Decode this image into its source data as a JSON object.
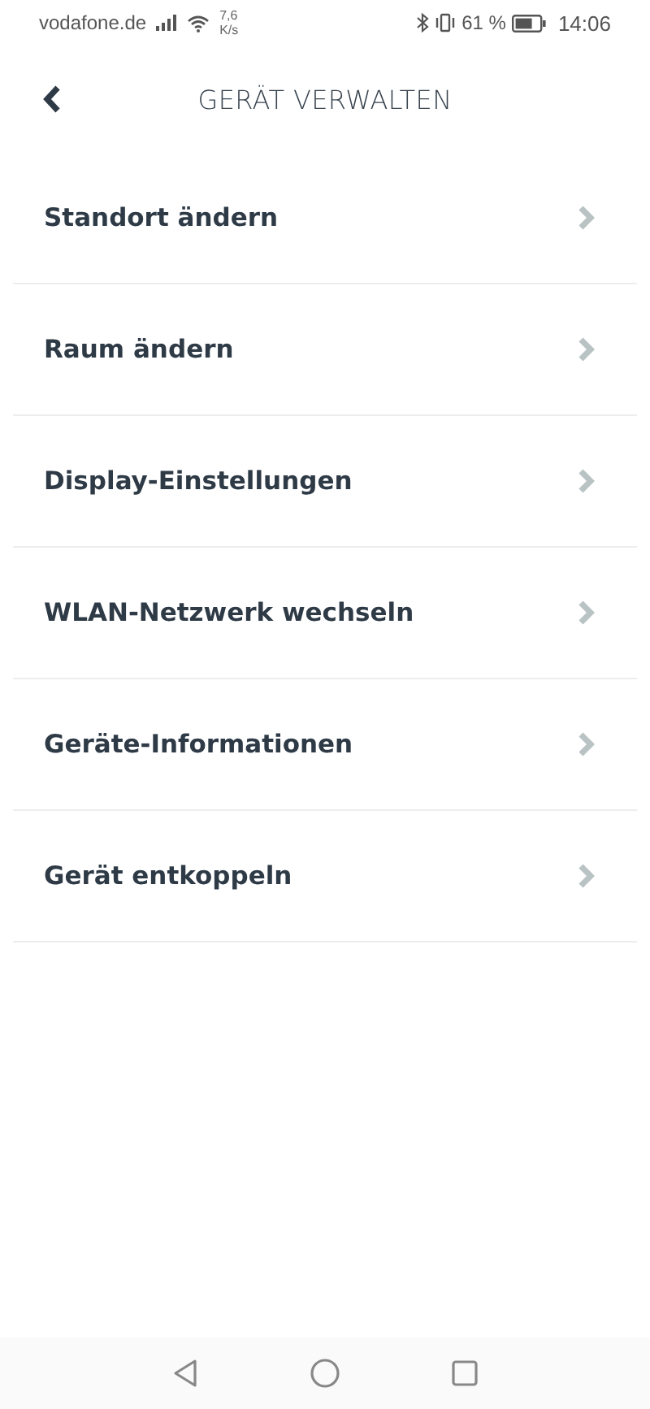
{
  "status_bar": {
    "carrier": "vodafone.de",
    "speed_value": "7,6",
    "speed_unit": "K/s",
    "battery_percent": "61 %",
    "time": "14:06"
  },
  "header": {
    "title": "GERÄT VERWALTEN"
  },
  "menu_items": [
    {
      "label": "Standort ändern"
    },
    {
      "label": "Raum ändern"
    },
    {
      "label": "Display-Einstellungen"
    },
    {
      "label": "WLAN-Netzwerk wechseln"
    },
    {
      "label": "Geräte-Informationen"
    },
    {
      "label": "Gerät entkoppeln"
    }
  ]
}
